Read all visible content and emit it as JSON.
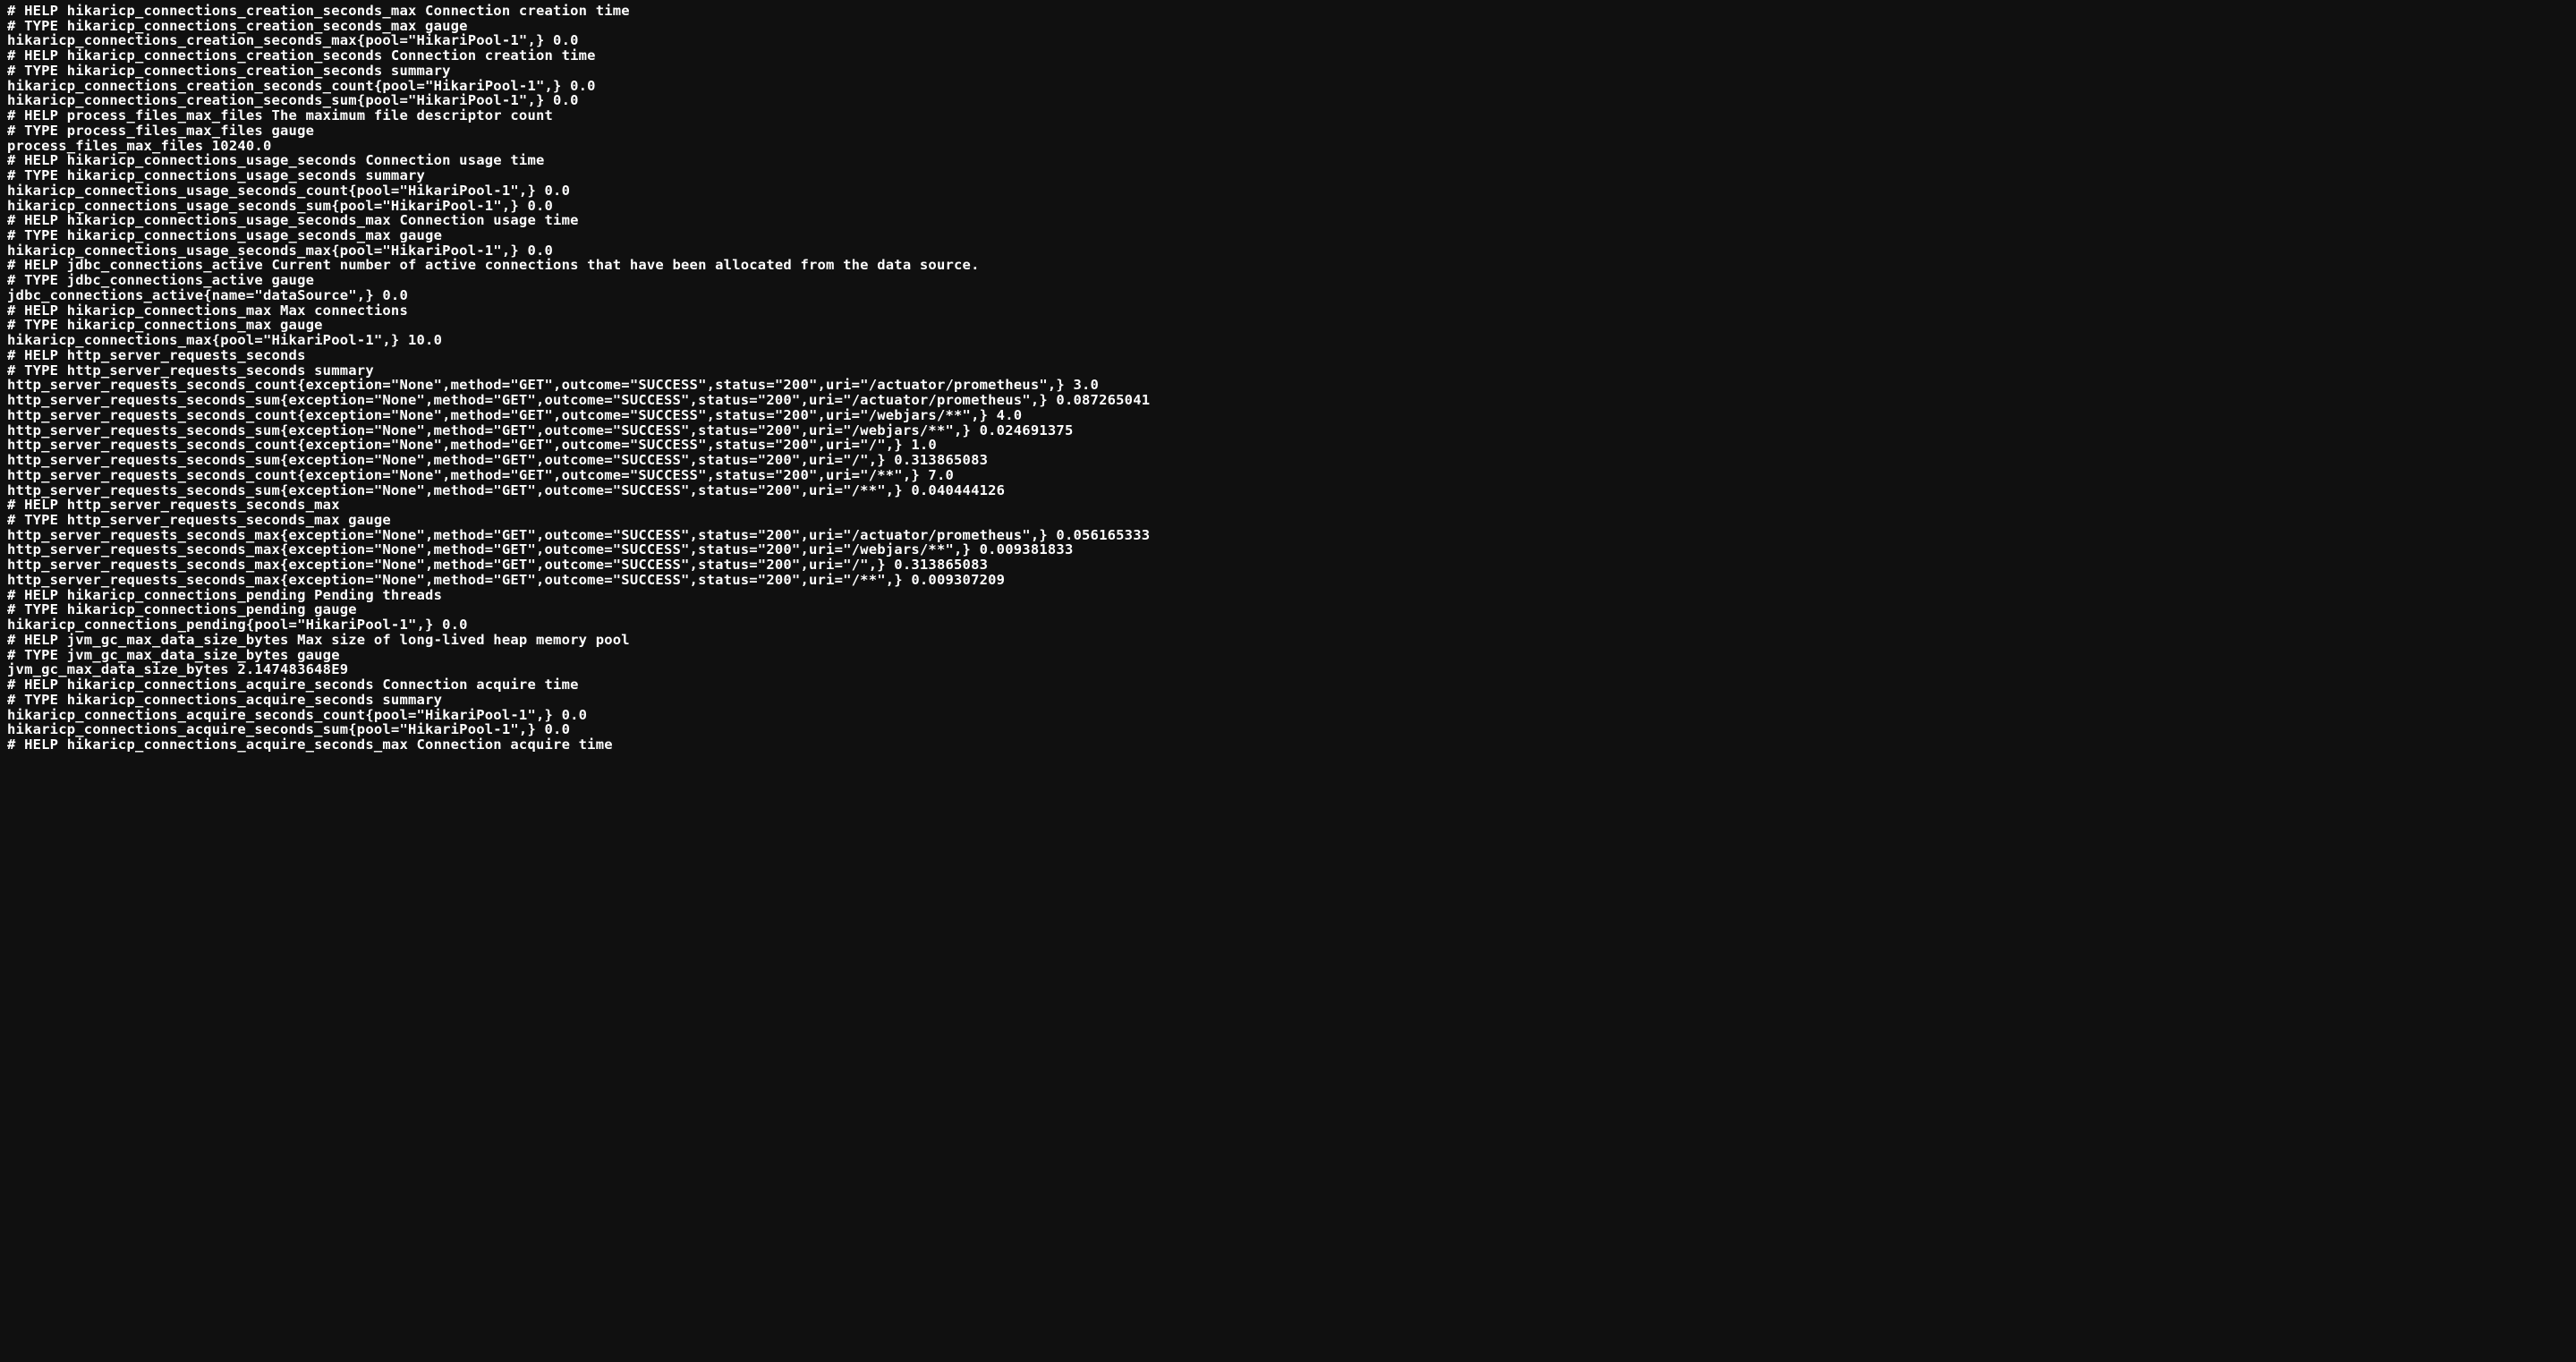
{
  "metrics_text": "# HELP hikaricp_connections_creation_seconds_max Connection creation time\n# TYPE hikaricp_connections_creation_seconds_max gauge\nhikaricp_connections_creation_seconds_max{pool=\"HikariPool-1\",} 0.0\n# HELP hikaricp_connections_creation_seconds Connection creation time\n# TYPE hikaricp_connections_creation_seconds summary\nhikaricp_connections_creation_seconds_count{pool=\"HikariPool-1\",} 0.0\nhikaricp_connections_creation_seconds_sum{pool=\"HikariPool-1\",} 0.0\n# HELP process_files_max_files The maximum file descriptor count\n# TYPE process_files_max_files gauge\nprocess_files_max_files 10240.0\n# HELP hikaricp_connections_usage_seconds Connection usage time\n# TYPE hikaricp_connections_usage_seconds summary\nhikaricp_connections_usage_seconds_count{pool=\"HikariPool-1\",} 0.0\nhikaricp_connections_usage_seconds_sum{pool=\"HikariPool-1\",} 0.0\n# HELP hikaricp_connections_usage_seconds_max Connection usage time\n# TYPE hikaricp_connections_usage_seconds_max gauge\nhikaricp_connections_usage_seconds_max{pool=\"HikariPool-1\",} 0.0\n# HELP jdbc_connections_active Current number of active connections that have been allocated from the data source.\n# TYPE jdbc_connections_active gauge\njdbc_connections_active{name=\"dataSource\",} 0.0\n# HELP hikaricp_connections_max Max connections\n# TYPE hikaricp_connections_max gauge\nhikaricp_connections_max{pool=\"HikariPool-1\",} 10.0\n# HELP http_server_requests_seconds  \n# TYPE http_server_requests_seconds summary\nhttp_server_requests_seconds_count{exception=\"None\",method=\"GET\",outcome=\"SUCCESS\",status=\"200\",uri=\"/actuator/prometheus\",} 3.0\nhttp_server_requests_seconds_sum{exception=\"None\",method=\"GET\",outcome=\"SUCCESS\",status=\"200\",uri=\"/actuator/prometheus\",} 0.087265041\nhttp_server_requests_seconds_count{exception=\"None\",method=\"GET\",outcome=\"SUCCESS\",status=\"200\",uri=\"/webjars/**\",} 4.0\nhttp_server_requests_seconds_sum{exception=\"None\",method=\"GET\",outcome=\"SUCCESS\",status=\"200\",uri=\"/webjars/**\",} 0.024691375\nhttp_server_requests_seconds_count{exception=\"None\",method=\"GET\",outcome=\"SUCCESS\",status=\"200\",uri=\"/\",} 1.0\nhttp_server_requests_seconds_sum{exception=\"None\",method=\"GET\",outcome=\"SUCCESS\",status=\"200\",uri=\"/\",} 0.313865083\nhttp_server_requests_seconds_count{exception=\"None\",method=\"GET\",outcome=\"SUCCESS\",status=\"200\",uri=\"/**\",} 7.0\nhttp_server_requests_seconds_sum{exception=\"None\",method=\"GET\",outcome=\"SUCCESS\",status=\"200\",uri=\"/**\",} 0.040444126\n# HELP http_server_requests_seconds_max  \n# TYPE http_server_requests_seconds_max gauge\nhttp_server_requests_seconds_max{exception=\"None\",method=\"GET\",outcome=\"SUCCESS\",status=\"200\",uri=\"/actuator/prometheus\",} 0.056165333\nhttp_server_requests_seconds_max{exception=\"None\",method=\"GET\",outcome=\"SUCCESS\",status=\"200\",uri=\"/webjars/**\",} 0.009381833\nhttp_server_requests_seconds_max{exception=\"None\",method=\"GET\",outcome=\"SUCCESS\",status=\"200\",uri=\"/\",} 0.313865083\nhttp_server_requests_seconds_max{exception=\"None\",method=\"GET\",outcome=\"SUCCESS\",status=\"200\",uri=\"/**\",} 0.009307209\n# HELP hikaricp_connections_pending Pending threads\n# TYPE hikaricp_connections_pending gauge\nhikaricp_connections_pending{pool=\"HikariPool-1\",} 0.0\n# HELP jvm_gc_max_data_size_bytes Max size of long-lived heap memory pool\n# TYPE jvm_gc_max_data_size_bytes gauge\njvm_gc_max_data_size_bytes 2.147483648E9\n# HELP hikaricp_connections_acquire_seconds Connection acquire time\n# TYPE hikaricp_connections_acquire_seconds summary\nhikaricp_connections_acquire_seconds_count{pool=\"HikariPool-1\",} 0.0\nhikaricp_connections_acquire_seconds_sum{pool=\"HikariPool-1\",} 0.0\n# HELP hikaricp_connections_acquire_seconds_max Connection acquire time"
}
